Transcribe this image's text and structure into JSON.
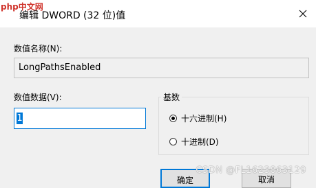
{
  "window": {
    "title": "编辑 DWORD (32 位)值",
    "close_icon": "close-icon",
    "logo_text": "php中文网"
  },
  "value_name": {
    "label": "数值名称(N):",
    "value": "LongPathsEnabled"
  },
  "value_data": {
    "label": "数值数据(V):",
    "value": "1"
  },
  "base": {
    "label": "基数",
    "options": [
      {
        "label": "十六进制(H)",
        "selected": true
      },
      {
        "label": "十进制(D)",
        "selected": false
      }
    ]
  },
  "buttons": {
    "ok_label": "确定",
    "cancel_label": "取消"
  },
  "watermark": "CSDN @FL1623863129",
  "colors": {
    "accent": "#0078d7",
    "background": "#f0f0f0"
  }
}
